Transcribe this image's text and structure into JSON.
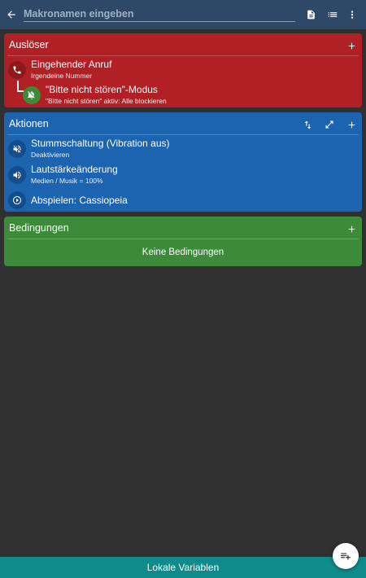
{
  "appbar": {
    "name_placeholder": "Makronamen eingeben",
    "icons": [
      "arrow-left-icon",
      "document-icon",
      "list-icon",
      "more-vert-icon"
    ]
  },
  "triggers": {
    "title": "Auslöser",
    "items": [
      {
        "icon": "phone-icon",
        "title": "Eingehender Anruf",
        "subtitle": "Irgendeine Nummer"
      },
      {
        "icon": "bell-off-icon",
        "title": "\"Bitte nicht stören\"-Modus",
        "subtitle": "\"Bitte nicht stören\" aktiv: Alle blockieren"
      }
    ]
  },
  "actions": {
    "title": "Aktionen",
    "items": [
      {
        "icon": "volume-off-icon",
        "title": "Stummschaltung (Vibration aus)",
        "subtitle": "Deaktivieren"
      },
      {
        "icon": "volume-up-icon",
        "title": "Lautstärkeänderung",
        "subtitle": "Medien / Musik = 100%"
      },
      {
        "icon": "play-circle-icon",
        "title": "Abspielen: Cassiopeia",
        "subtitle": ""
      }
    ]
  },
  "conditions": {
    "title": "Bedingungen",
    "empty_text": "Keine Bedingungen"
  },
  "bottom_bar": {
    "label": "Lokale Variablen"
  },
  "colors": {
    "appbar": "#2e4967",
    "background": "#303030",
    "trigger_card": "#b02024",
    "action_card": "#1c63b0",
    "condition_card": "#3c8a3a",
    "bottom_bar": "#0f8b8b"
  }
}
